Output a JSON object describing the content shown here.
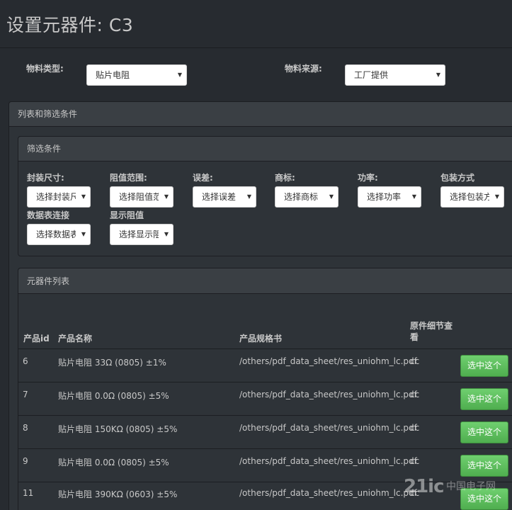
{
  "page": {
    "title": "设置元器件: C3"
  },
  "material": {
    "type_label": "物料类型:",
    "type_value": "贴片电阻",
    "source_label": "物料来源:",
    "source_value": "工厂提供"
  },
  "outer_panel": {
    "title": "列表和筛选条件"
  },
  "filter": {
    "title": "筛选条件",
    "fields": [
      {
        "label": "封装尺寸:",
        "value": "选择封装尺寸"
      },
      {
        "label": "阻值范围:",
        "value": "选择阻值范围"
      },
      {
        "label": "误差:",
        "value": "选择误差"
      },
      {
        "label": "商标:",
        "value": "选择商标"
      },
      {
        "label": "功率:",
        "value": "选择功率"
      },
      {
        "label": "包装方式",
        "value": "选择包装方式"
      },
      {
        "label": "数据表连接",
        "value": "选择数据表连接"
      },
      {
        "label": "显示阻值",
        "value": "选择显示阻值"
      }
    ]
  },
  "list": {
    "title": "元器件列表",
    "headers": {
      "id": "产品id",
      "name": "产品名称",
      "spec": "产品规格书",
      "detail": "原件细节查看"
    },
    "rows": [
      {
        "id": "6",
        "name": "贴片电阻 33Ω (0805) ±1%",
        "spec": "/others/pdf_data_sheet/res_uniohm_lc.pdf",
        "detail": "cc",
        "action": "选中这个"
      },
      {
        "id": "7",
        "name": "贴片电阻 0.0Ω (0805) ±5%",
        "spec": "/others/pdf_data_sheet/res_uniohm_lc.pdf",
        "detail": "cc",
        "action": "选中这个"
      },
      {
        "id": "8",
        "name": "贴片电阻 150KΩ (0805) ±5%",
        "spec": "/others/pdf_data_sheet/res_uniohm_lc.pdf",
        "detail": "cc",
        "action": "选中这个"
      },
      {
        "id": "9",
        "name": "贴片电阻 0.0Ω (0805) ±5%",
        "spec": "/others/pdf_data_sheet/res_uniohm_lc.pdf",
        "detail": "cc",
        "action": "选中这个"
      },
      {
        "id": "11",
        "name": "贴片电阻 390KΩ (0603) ±5%",
        "spec": "/others/pdf_data_sheet/res_uniohm_lc.pdf",
        "detail": "cc",
        "action": "选中这个"
      }
    ]
  },
  "watermark": {
    "logo": "21ic",
    "sub": "中国电子网"
  },
  "colors": {
    "accent_button": "#5cb85c",
    "background": "#272b30",
    "panel_header": "#3a3f44"
  }
}
